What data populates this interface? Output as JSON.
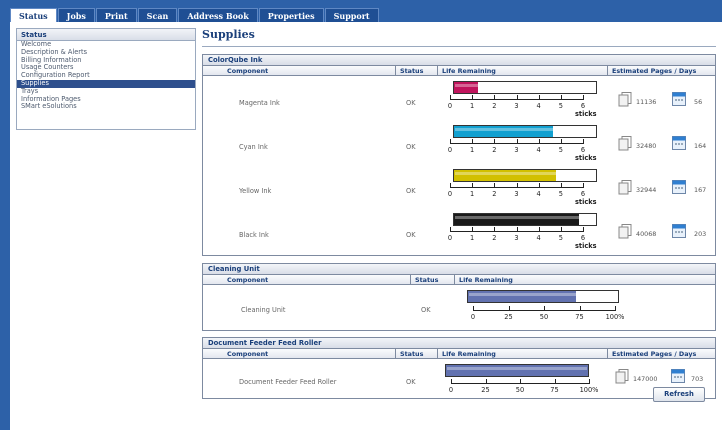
{
  "tabs": [
    {
      "label": "Status",
      "active": true
    },
    {
      "label": "Jobs",
      "active": false
    },
    {
      "label": "Print",
      "active": false
    },
    {
      "label": "Scan",
      "active": false
    },
    {
      "label": "Address Book",
      "active": false
    },
    {
      "label": "Properties",
      "active": false
    },
    {
      "label": "Support",
      "active": false
    }
  ],
  "sidebar": {
    "title": "Status",
    "items": [
      {
        "label": "Welcome",
        "selected": false
      },
      {
        "label": "Description & Alerts",
        "selected": false
      },
      {
        "label": "Billing Information",
        "selected": false
      },
      {
        "label": "Usage Counters",
        "selected": false
      },
      {
        "label": "Configuration Report",
        "selected": false
      },
      {
        "label": "Supplies",
        "selected": true
      },
      {
        "label": "Trays",
        "selected": false
      },
      {
        "label": "Information Pages",
        "selected": false
      },
      {
        "label": "SMart eSolutions",
        "selected": false
      }
    ]
  },
  "page_title": "Supplies",
  "ink": {
    "title": "ColorQube Ink",
    "headers": {
      "component": "Component",
      "status": "Status",
      "life": "Life Remaining",
      "estimate": "Estimated Pages / Days"
    },
    "scale_labels": [
      "0",
      "1",
      "2",
      "3",
      "4",
      "5",
      "6"
    ],
    "unit": "sticks",
    "rows": [
      {
        "component": "Magenta Ink",
        "status": "OK",
        "life_sticks": 1.0,
        "color": "#c0145c",
        "pages": "11136",
        "days": "56"
      },
      {
        "component": "Cyan Ink",
        "status": "OK",
        "life_sticks": 4.2,
        "color": "#12a0d0",
        "pages": "32480",
        "days": "164"
      },
      {
        "component": "Yellow Ink",
        "status": "OK",
        "life_sticks": 4.3,
        "color": "#d2c000",
        "pages": "32944",
        "days": "167"
      },
      {
        "component": "Black Ink",
        "status": "OK",
        "life_sticks": 5.3,
        "color": "#1a1a1a",
        "pages": "40068",
        "days": "203"
      }
    ]
  },
  "cleaning": {
    "title": "Cleaning Unit",
    "headers": {
      "component": "Component",
      "status": "Status",
      "life": "Life Remaining"
    },
    "scale_labels": [
      "0",
      "25",
      "50",
      "75",
      "100%"
    ],
    "row": {
      "component": "Cleaning Unit",
      "status": "OK",
      "life_percent": 72,
      "color": "#6272b0"
    }
  },
  "feeder": {
    "title": "Document Feeder Feed Roller",
    "headers": {
      "component": "Component",
      "status": "Status",
      "life": "Life Remaining",
      "estimate": "Estimated Pages / Days"
    },
    "scale_labels": [
      "0",
      "25",
      "50",
      "75",
      "100%"
    ],
    "row": {
      "component": "Document Feeder Feed Roller",
      "status": "OK",
      "life_percent": 100,
      "color": "#6272b0",
      "pages": "147000",
      "days": "703"
    }
  },
  "refresh_label": "Refresh",
  "colors": {
    "frame": "#2d61a8",
    "nav_selected": "#2e4f8d",
    "title": "#1a3f7a"
  }
}
